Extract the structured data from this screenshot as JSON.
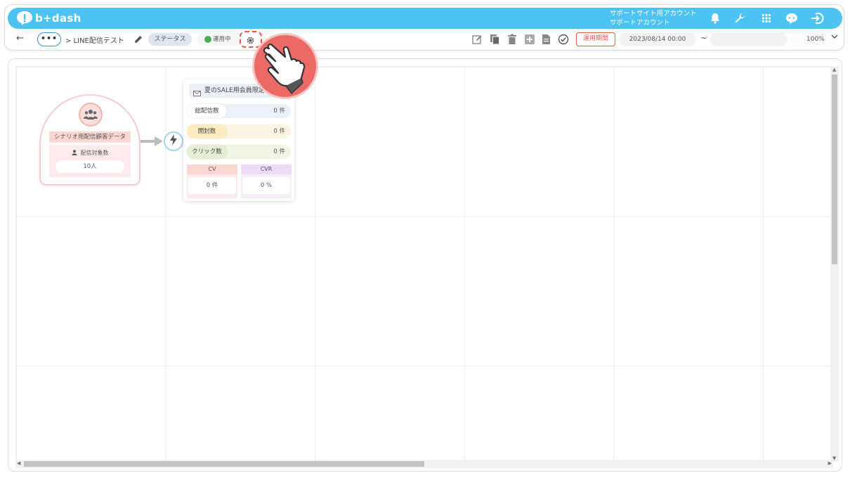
{
  "header": {
    "logo_text": "b+dash",
    "account_line1": "サポートサイト用アカウント",
    "account_line2": "サポートアカウント",
    "icons": [
      "bell-icon",
      "wrench-icon",
      "apps-grid-icon",
      "chat-support-icon",
      "logout-icon"
    ]
  },
  "toolbar": {
    "back_label": "←",
    "more_label": "•••",
    "breadcrumb": "> LINE配信テスト",
    "status_label": "ステータス",
    "running_label": "運用中",
    "period_button": "運用期間",
    "start_date": "2023/08/14 00:00",
    "tilde": "~",
    "end_date": "",
    "zoom": "100%",
    "colors": {
      "accent": "#4cc3f0",
      "highlight": "#e8554f",
      "running": "#4caf50"
    }
  },
  "segment_node": {
    "name": "シナリオ用配信顧客データ",
    "count_label": "配信対象数",
    "count_value": "10人"
  },
  "message_node": {
    "title": "夏のSALE用会員限定…",
    "metrics": [
      {
        "label": "総配信数",
        "value": "0 件",
        "color": "#eaf1f8"
      },
      {
        "label": "開封数",
        "value": "0 件",
        "color": "#fdf5e3"
      },
      {
        "label": "クリック数",
        "value": "0 件",
        "color": "#f1f5e6"
      }
    ],
    "cv": {
      "label": "CV",
      "value": "0 件",
      "color": "#fbd7d3"
    },
    "cvr": {
      "label": "CVR",
      "value": "0 %",
      "color": "#eedcf5"
    }
  }
}
